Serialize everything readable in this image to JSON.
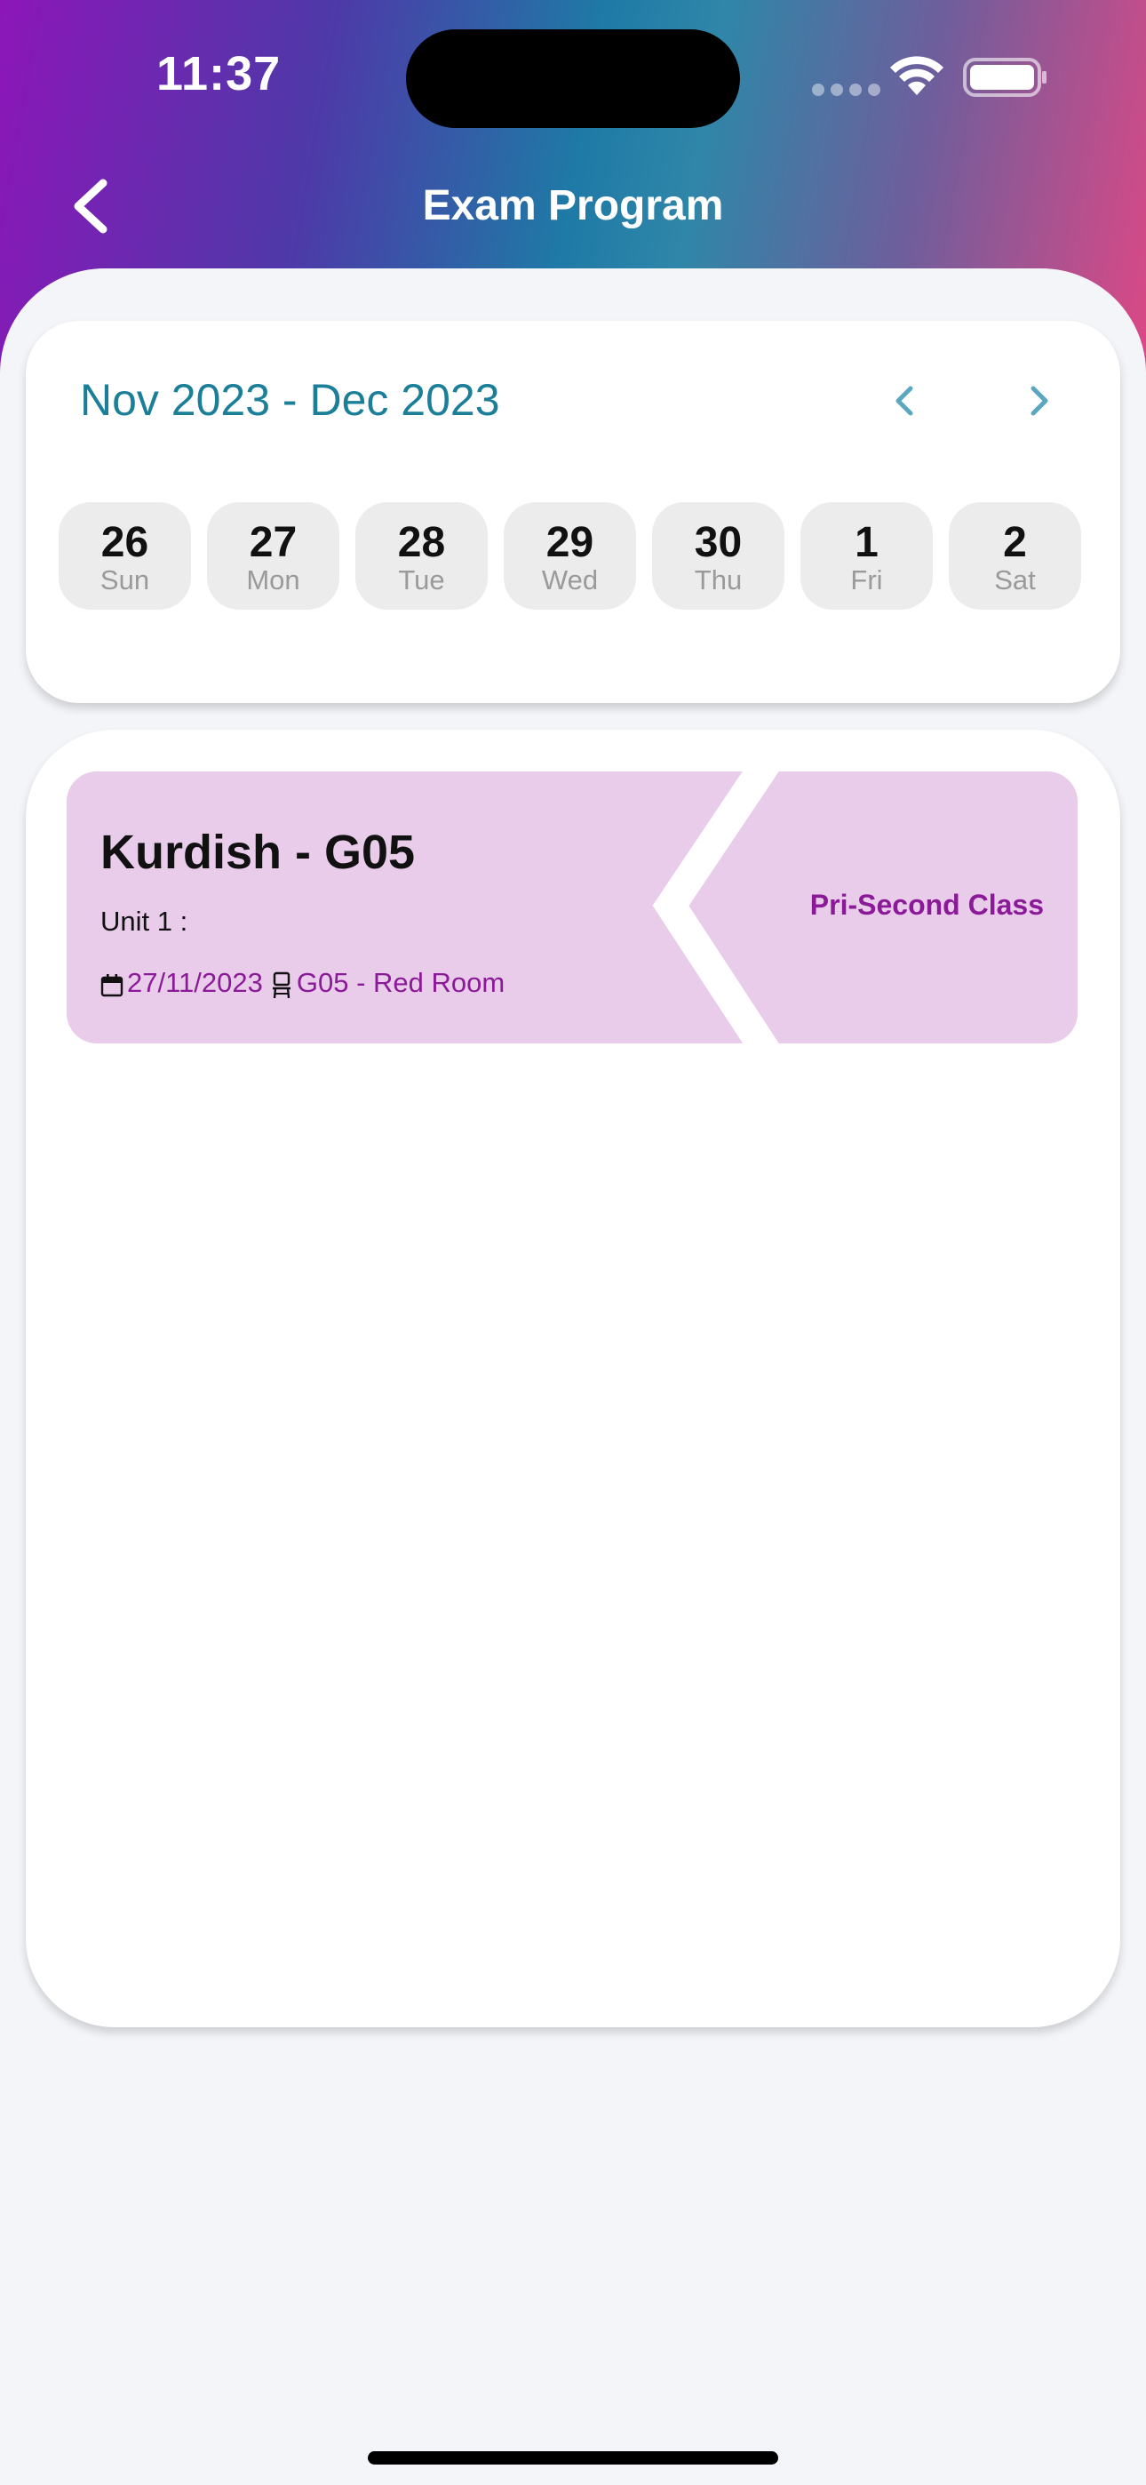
{
  "status_bar": {
    "time": "11:37"
  },
  "header": {
    "title": "Exam Program",
    "back_icon": "chevron-left-icon"
  },
  "calendar": {
    "range_label": "Nov 2023 - Dec 2023",
    "prev_icon": "chevron-left-icon",
    "next_icon": "chevron-right-icon",
    "days": [
      {
        "num": "26",
        "name": "Sun"
      },
      {
        "num": "27",
        "name": "Mon"
      },
      {
        "num": "28",
        "name": "Tue"
      },
      {
        "num": "29",
        "name": "Wed"
      },
      {
        "num": "30",
        "name": "Thu"
      },
      {
        "num": "1",
        "name": "Fri"
      },
      {
        "num": "2",
        "name": "Sat"
      }
    ]
  },
  "exams": [
    {
      "title": "Kurdish - G05",
      "unit": "Unit 1 :",
      "date": "27/11/2023",
      "room": "G05 - Red Room",
      "class_name": "Pri-Second Class",
      "date_icon": "calendar-icon",
      "room_icon": "chair-icon"
    }
  ],
  "colors": {
    "accent_teal": "#1b7f99",
    "exam_purple": "#8b1a98",
    "exam_card_bg": "#e9cbea",
    "chip_bg": "#ececec"
  }
}
